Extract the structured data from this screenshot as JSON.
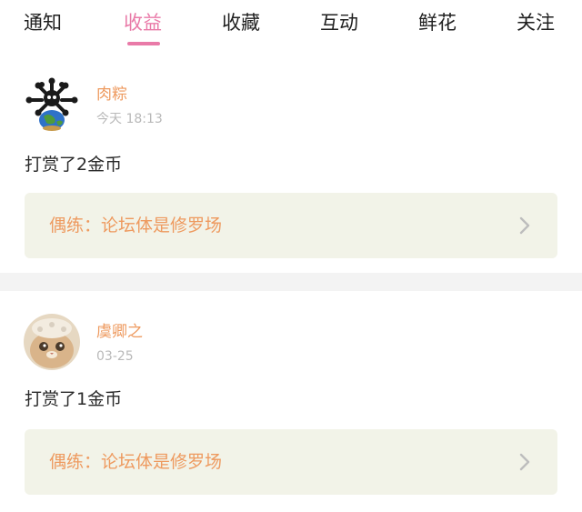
{
  "tabs": [
    {
      "label": "通知",
      "active": false
    },
    {
      "label": "收益",
      "active": true
    },
    {
      "label": "收藏",
      "active": false
    },
    {
      "label": "互动",
      "active": false
    },
    {
      "label": "鲜花",
      "active": false
    },
    {
      "label": "关注",
      "active": false
    }
  ],
  "accent_color": "#e97aa8",
  "name_color": "#ee9a5f",
  "items": [
    {
      "username": "肉粽",
      "time": "今天 18:13",
      "action": "打赏了2金币",
      "reference": "偶练：论坛体是修罗场",
      "avatar_icon": "earth-bones-avatar"
    },
    {
      "username": "虞卿之",
      "time": "03-25",
      "action": "打赏了1金币",
      "reference": "偶练：论坛体是修罗场",
      "avatar_icon": "cat-avatar"
    }
  ]
}
